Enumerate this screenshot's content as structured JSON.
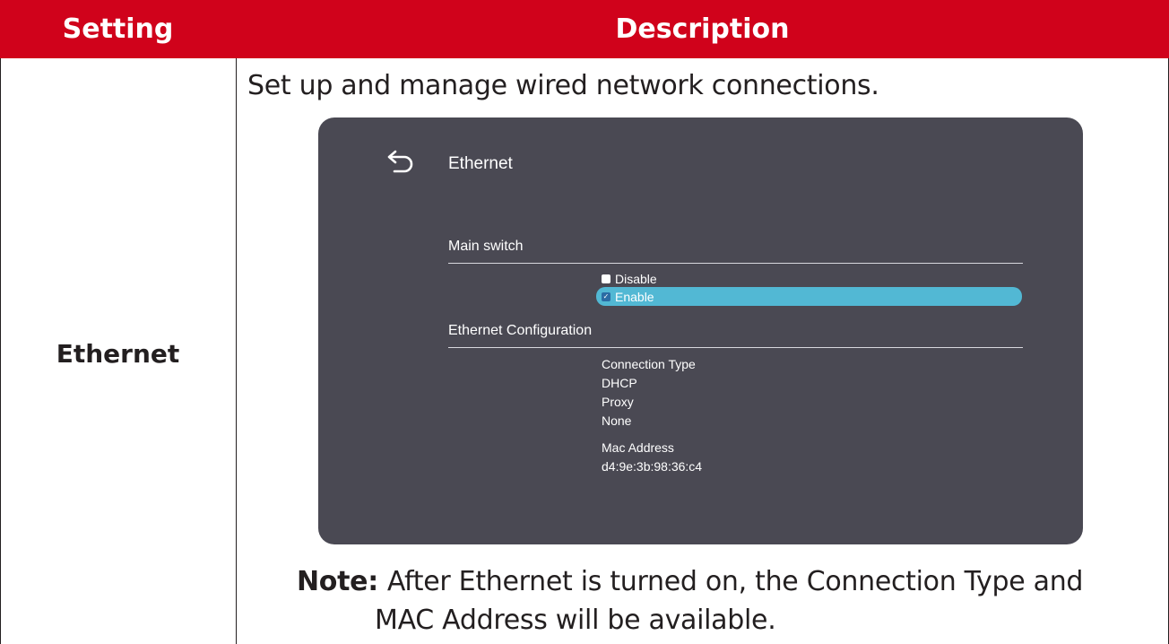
{
  "table": {
    "header": {
      "setting": "Setting",
      "description": "Description"
    },
    "row": {
      "setting": "Ethernet",
      "intro": "Set up and manage wired network connections.",
      "note_label": "Note:",
      "note_line1": "After Ethernet is turned on, the Connection Type and",
      "note_line2": "MAC Address will be available."
    }
  },
  "screen": {
    "back_icon": "back-arrow-icon",
    "title": "Ethernet",
    "main_switch_label": "Main switch",
    "options": [
      {
        "label": "Disable",
        "checked": false
      },
      {
        "label": "Enable",
        "checked": true
      }
    ],
    "config_label": "Ethernet Configuration",
    "connection_type_label": "Connection Type",
    "connection_values": [
      "DHCP",
      "Proxy",
      "None"
    ],
    "mac_label": "Mac Address",
    "mac_value": "d4:9e:3b:98:36:c4"
  },
  "colors": {
    "header_red": "#d0021b",
    "panel_bg": "#4a4953",
    "highlight": "#52b8d4"
  }
}
